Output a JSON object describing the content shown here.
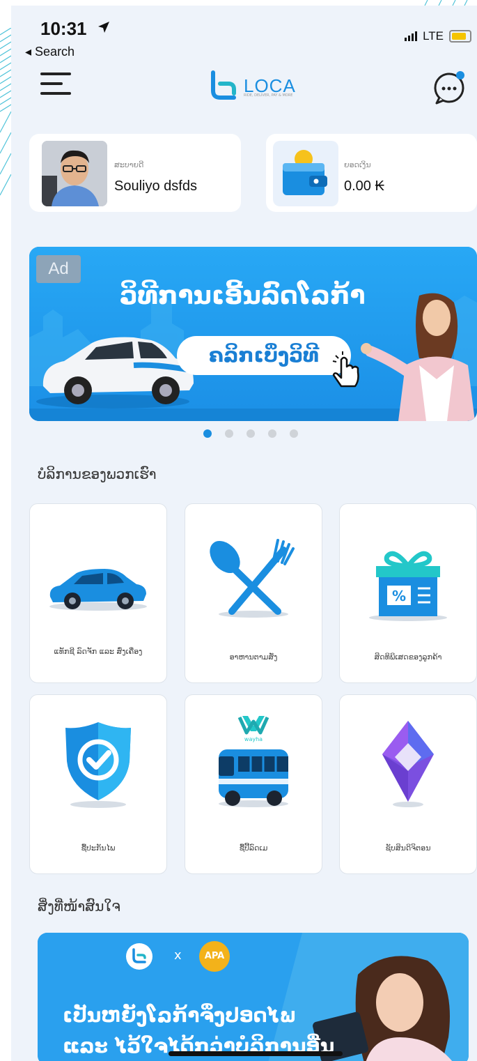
{
  "status_bar": {
    "time": "10:31",
    "back_label": "◂ Search",
    "network": "LTE"
  },
  "header": {
    "logo_text": "LOCA",
    "logo_tagline": "RIDE, DELIVER, PAY & MORE"
  },
  "user_card": {
    "label": "ສະບາຍດີ",
    "name": "Souliyo dsfds"
  },
  "wallet_card": {
    "label": "ຍອດເງິນ",
    "balance": "0.00 ₭"
  },
  "banner": {
    "ad_label": "Ad",
    "title": "ວິທີການເອີ້ນລົດໂລກ້າ",
    "button_label": "ຄລິກເບິ່ງວິທີ",
    "page_count": 5,
    "active_index": 0
  },
  "services": {
    "title": "ບໍລິການຂອງພວກເຮົາ",
    "items": [
      {
        "label": "ແທັກຊີ ລົດຈັກ ແລະ ສົ່ງເຄື່ອງ",
        "icon": "car-icon"
      },
      {
        "label": "ອາຫານຕາມສັ່ງ",
        "icon": "food-icon"
      },
      {
        "label": "ສິດທິພິເສດຂອງລູກຄ້າ",
        "icon": "gift-icon"
      },
      {
        "label": "ຊື້ປະກັນໄພ",
        "icon": "shield-check-icon"
      },
      {
        "label": "ຊື້ປີ້ລົດເມ",
        "icon": "bus-icon"
      },
      {
        "label": "ຊັບສິນດິຈິຕອນ",
        "icon": "diamond-icon"
      }
    ]
  },
  "interest": {
    "title": "ສິ່ງທີ່ໜ້າສົນໃຈ",
    "partner_logo": "APA",
    "times_mark": "x",
    "headline_1": "ເປັນຫຍັງໂລກ້າຈຶ່ງປອດໄພ",
    "headline_2": "ແລະ ໄວ້ໃຈໄດ້ກວ່າບໍລິການອື່ນ"
  },
  "colors": {
    "accent": "#1a8ee0",
    "background": "#eef3fa",
    "banner": "#1f9bf0"
  }
}
